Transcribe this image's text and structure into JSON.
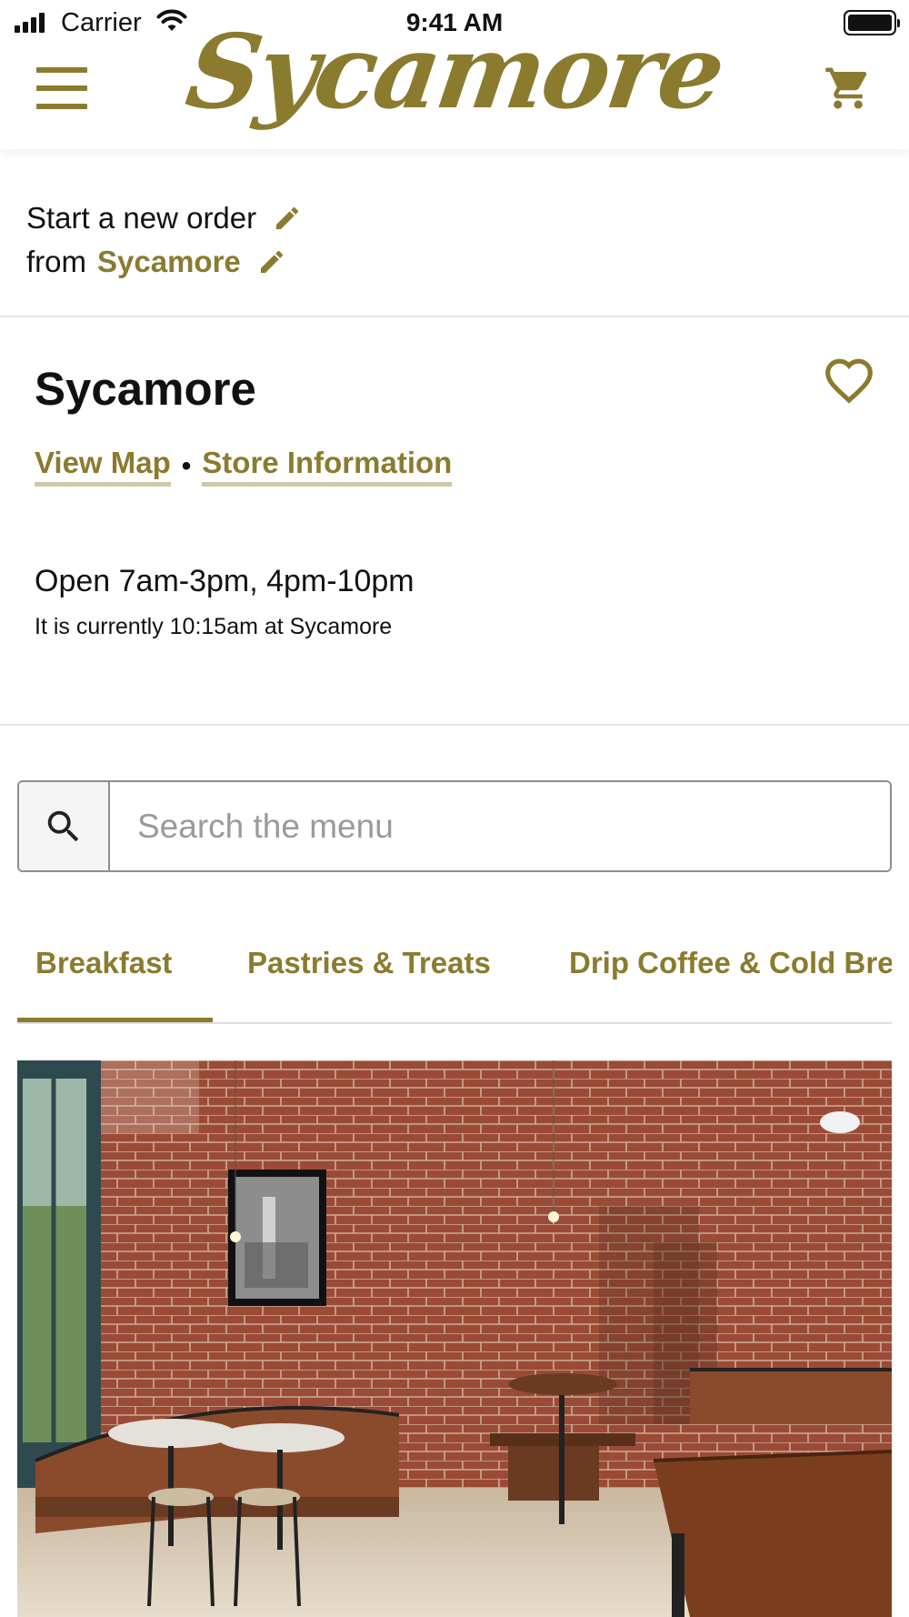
{
  "status_bar": {
    "carrier": "Carrier",
    "time": "9:41 AM"
  },
  "header": {
    "logo_text": "Sycamore",
    "menu_icon": "hamburger-menu-icon",
    "cart_icon": "shopping-cart-icon"
  },
  "order": {
    "line1_text": "Start a new order",
    "line2_prefix": "from",
    "store_name": "Sycamore",
    "edit_icon": "pencil-icon"
  },
  "store": {
    "name": "Sycamore",
    "favorite_icon": "heart-outline-icon",
    "view_map_label": "View Map",
    "separator": "•",
    "store_info_label": "Store Information",
    "hours": "Open 7am-3pm, 4pm-10pm",
    "current_time_text": "It is currently 10:15am at Sycamore"
  },
  "search": {
    "placeholder": "Search the menu",
    "value": "",
    "icon": "search-icon"
  },
  "tabs": [
    {
      "label": "Breakfast",
      "active": true
    },
    {
      "label": "Pastries & Treats",
      "active": false
    },
    {
      "label": "Drip Coffee & Cold Brew",
      "active": false
    }
  ],
  "hero": {
    "image": "restaurant-interior-photo"
  },
  "colors": {
    "brand": "#8a7b2f",
    "link_underline": "#cfc8a6",
    "text": "#111111",
    "divider": "#e4e4e4"
  }
}
